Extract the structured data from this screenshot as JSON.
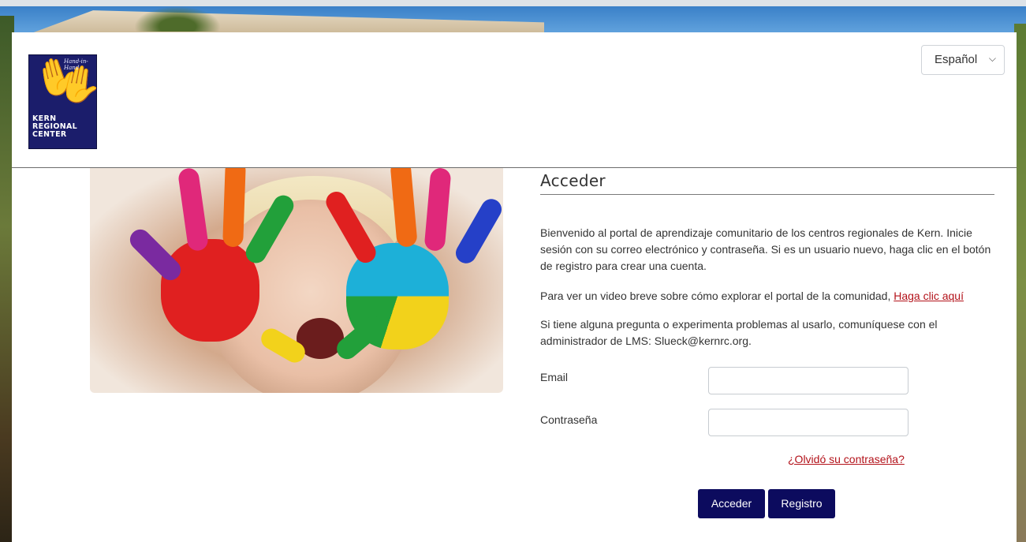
{
  "header": {
    "logo": {
      "tagline": "Hand-in-Hand",
      "name_line1": "KERN",
      "name_line2": "REGIONAL",
      "name_line3": "CENTER"
    },
    "language_select": {
      "selected": "Español"
    }
  },
  "form": {
    "title": "Acceder",
    "intro": "Bienvenido al portal de aprendizaje comunitario de los centros regionales de Kern. Inicie sesión con su correo electrónico y contraseña. Si es un usuario nuevo, haga clic en el botón de registro para crear una cuenta.",
    "video_text": "Para ver un video breve sobre cómo explorar el portal de la comunidad, ",
    "video_link": "Haga clic aquí",
    "contact": "Si tiene alguna pregunta o experimenta problemas al usarlo, comuníquese con el administrador de LMS: Slueck@kernrc.org.",
    "email_label": "Email",
    "password_label": "Contraseña",
    "forgot_link": "¿Olvidó su contraseña?",
    "login_button": "Acceder",
    "register_button": "Registro"
  },
  "colors": {
    "button": "#0c0b5e",
    "link": "#b3121a",
    "logo_bg": "#1b1d6b"
  },
  "icons": {
    "select_chevron": "chevron-down-icon"
  }
}
